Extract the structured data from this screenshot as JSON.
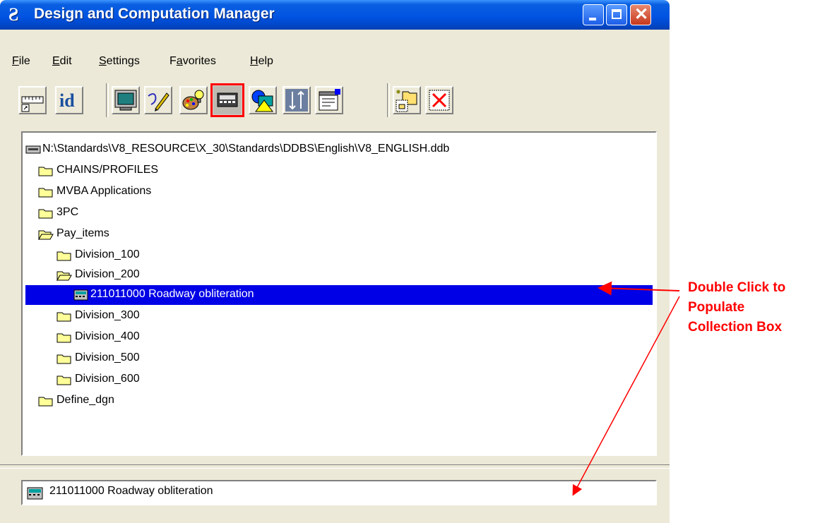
{
  "window": {
    "title": "Design and Computation Manager",
    "app_icon_glyph": "Ƨ",
    "controls": {
      "minimize": "minimize",
      "maximize": "maximize",
      "close": "✕"
    }
  },
  "menu": [
    {
      "label": "File",
      "accel": "F",
      "rest": "ile"
    },
    {
      "label": "Edit",
      "accel": "E",
      "rest": "dit"
    },
    {
      "label": "Settings",
      "accel": "S",
      "rest": "ettings"
    },
    {
      "label": "Favorites",
      "pre": "F",
      "accel": "a",
      "rest": "vorites"
    },
    {
      "label": "Help",
      "accel": "H",
      "rest": "elp"
    }
  ],
  "toolbar": [
    {
      "name": "ruler-icon",
      "state": "raised"
    },
    {
      "name": "id-icon",
      "text": "id",
      "state": "raised"
    },
    {
      "name": "monitor-icon",
      "state": "raised"
    },
    {
      "name": "draw-pencil-icon",
      "state": "raised"
    },
    {
      "name": "palette-icon",
      "state": "raised"
    },
    {
      "name": "calculator-icon",
      "state": "pressed",
      "highlight": "#ff0000"
    },
    {
      "name": "shapes-icon",
      "state": "raised"
    },
    {
      "name": "sort-icon",
      "state": "raised"
    },
    {
      "name": "properties-icon",
      "state": "raised"
    },
    {
      "name": "new-folder-icon",
      "state": "raised"
    },
    {
      "name": "delete-icon",
      "state": "raised"
    }
  ],
  "tree": {
    "root": "N:\\Standards\\V8_RESOURCE\\X_30\\Standards\\DDBS\\English\\V8_ENGLISH.ddb",
    "items": [
      {
        "label": "CHAINS/PROFILES",
        "level": 1,
        "icon": "folder-closed-icon"
      },
      {
        "label": "MVBA Applications",
        "level": 1,
        "icon": "folder-closed-icon"
      },
      {
        "label": "3PC",
        "level": 1,
        "icon": "folder-closed-icon"
      },
      {
        "label": "Pay_items",
        "level": 1,
        "icon": "folder-open-icon"
      },
      {
        "label": "Division_100",
        "level": 2,
        "icon": "folder-closed-icon"
      },
      {
        "label": "Division_200",
        "level": 2,
        "icon": "folder-open-icon"
      },
      {
        "label": "211011000 Roadway obliteration",
        "level": 3,
        "icon": "calculator-item-icon",
        "selected": true
      },
      {
        "label": "Division_300",
        "level": 2,
        "icon": "folder-closed-icon"
      },
      {
        "label": "Division_400",
        "level": 2,
        "icon": "folder-closed-icon"
      },
      {
        "label": "Division_500",
        "level": 2,
        "icon": "folder-closed-icon"
      },
      {
        "label": "Division_600",
        "level": 2,
        "icon": "folder-closed-icon"
      },
      {
        "label": "Define_dgn",
        "level": 1,
        "icon": "folder-closed-icon"
      }
    ]
  },
  "collection_box": {
    "text": "211011000 Roadway obliteration"
  },
  "annotation": {
    "text": "Double Click to\nPopulate\nCollection Box",
    "color": "#ff0000"
  },
  "colors": {
    "selection": "#0000e6",
    "titlebar": "#0054e3",
    "face": "#ece9d8"
  }
}
